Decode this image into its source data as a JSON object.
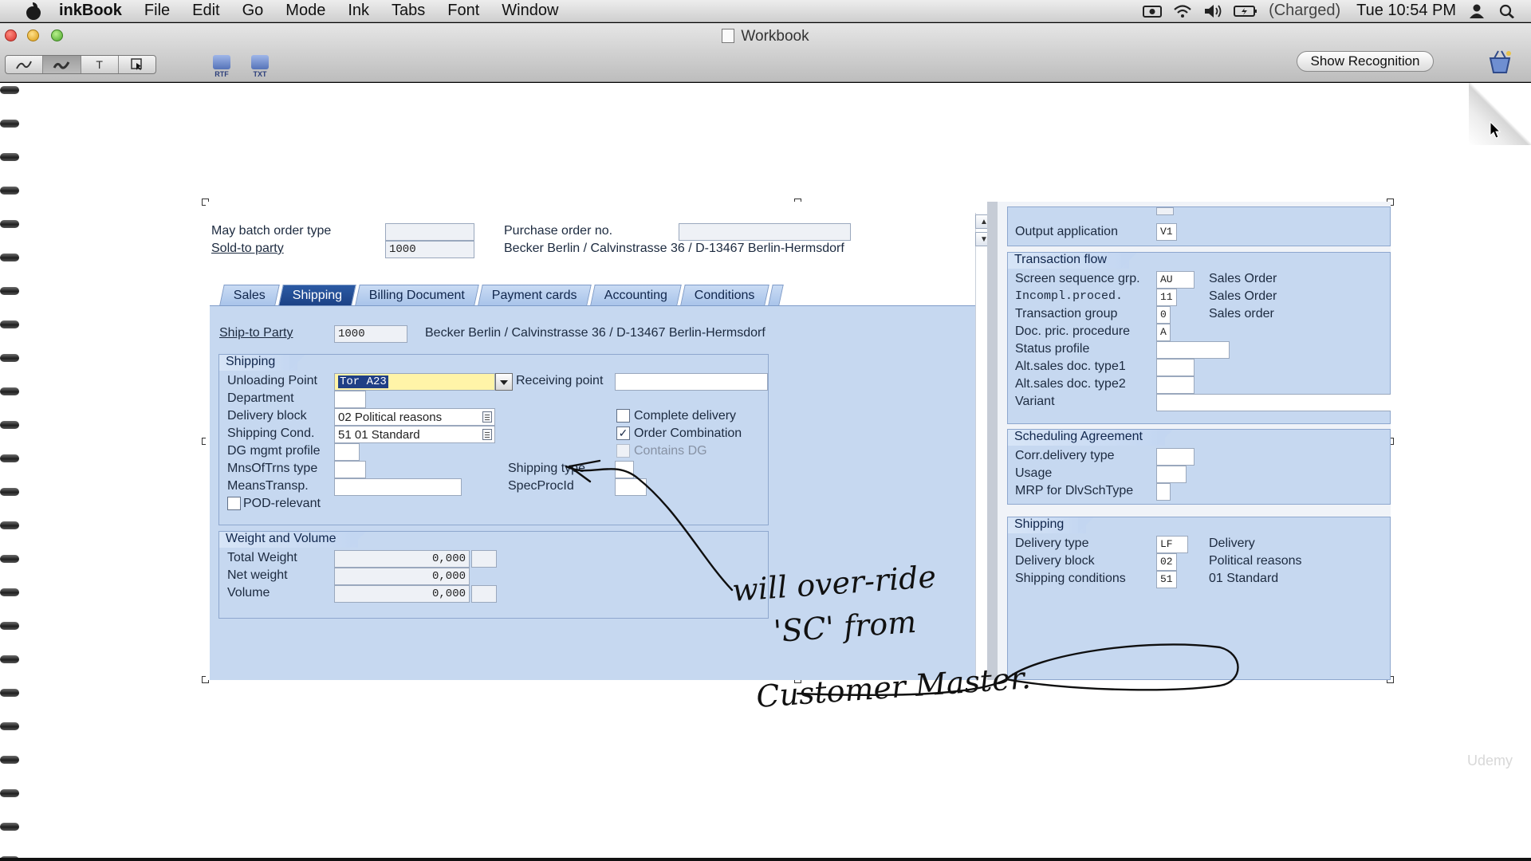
{
  "menubar": {
    "app_name": "inkBook",
    "items": [
      "File",
      "Edit",
      "Go",
      "Mode",
      "Ink",
      "Tabs",
      "Font",
      "Window"
    ],
    "battery_status": "(Charged)",
    "clock": "Tue 10:54 PM",
    "icons": [
      "screen-record-icon",
      "wifi-icon",
      "volume-icon",
      "battery-icon",
      "user-icon",
      "spotlight-search-icon"
    ]
  },
  "window": {
    "title": "Workbook",
    "tool_buttons": [
      "pen-tool",
      "highlighter-tool",
      "T",
      "select-tool"
    ],
    "export_rtf": "RTF",
    "export_txt": "TXT",
    "show_recognition": "Show Recognition"
  },
  "sap_left": {
    "may_batch_label": "May batch order type",
    "po_label": "Purchase order no.",
    "sold_to_label": "Sold-to party",
    "sold_to_value": "1000",
    "sold_to_address": "Becker Berlin / Calvinstrasse 36 / D-13467 Berlin-Hermsdorf",
    "tabs": [
      "Sales",
      "Shipping",
      "Billing Document",
      "Payment cards",
      "Accounting",
      "Conditions"
    ],
    "active_tab": "Shipping",
    "ship_to_label": "Ship-to Party",
    "ship_to_value": "1000",
    "ship_to_address": "Becker Berlin / Calvinstrasse 36 / D-13467 Berlin-Hermsdorf",
    "shipping_group": {
      "title": "Shipping",
      "unloading_point_label": "Unloading Point",
      "unloading_point_value": "Tor A23",
      "receiving_point_label": "Receiving point",
      "department_label": "Department",
      "delivery_block_label": "Delivery block",
      "delivery_block_value": "02  Political reasons",
      "shipping_cond_label": "Shipping Cond.",
      "shipping_cond_value": "51  01 Standard",
      "dg_label": "DG mgmt profile",
      "mns_label": "MnsOfTrns type",
      "shipping_type_label": "Shipping type",
      "means_label": "MeansTransp.",
      "spec_label": "SpecProcId",
      "pod_label": "POD-relevant",
      "complete_delivery_label": "Complete delivery",
      "order_combination_label": "Order Combination",
      "contains_dg_label": "Contains DG",
      "complete_delivery_checked": false,
      "order_combination_checked": true,
      "contains_dg_checked": false,
      "pod_checked": false
    },
    "weight_group": {
      "title": "Weight and Volume",
      "total_weight_label": "Total Weight",
      "total_weight_value": "0,000",
      "net_weight_label": "Net weight",
      "net_weight_value": "0,000",
      "volume_label": "Volume",
      "volume_value": "0,000"
    }
  },
  "sap_right": {
    "output_application_label": "Output application",
    "output_application_value": "V1",
    "transaction_flow": {
      "title": "Transaction flow",
      "rows": [
        {
          "label": "Screen sequence grp.",
          "value": "AU",
          "desc": "Sales Order"
        },
        {
          "label": "Incompl.proced.",
          "value": "11",
          "desc": "Sales Order"
        },
        {
          "label": "Transaction group",
          "value": "0",
          "desc": "Sales order"
        },
        {
          "label": "Doc. pric. procedure",
          "value": "A",
          "desc": ""
        },
        {
          "label": "Status profile",
          "value": "",
          "desc": ""
        },
        {
          "label": "Alt.sales doc. type1",
          "value": "",
          "desc": ""
        },
        {
          "label": "Alt.sales doc. type2",
          "value": "",
          "desc": ""
        },
        {
          "label": "Variant",
          "value": "",
          "desc": ""
        }
      ]
    },
    "scheduling_agreement": {
      "title": "Scheduling Agreement",
      "rows": [
        "Corr.delivery type",
        "Usage",
        "MRP for DlvSchType"
      ]
    },
    "shipping": {
      "title": "Shipping",
      "rows": [
        {
          "label": "Delivery type",
          "value": "LF",
          "desc": "Delivery"
        },
        {
          "label": "Delivery block",
          "value": "02",
          "desc": "Political reasons"
        },
        {
          "label": "Shipping conditions",
          "value": "51",
          "desc": "01 Standard"
        }
      ]
    }
  },
  "ink": {
    "line1": "will over-ride",
    "line2": "'SC' from",
    "line3": "Customer Master."
  },
  "watermark": "Udemy"
}
